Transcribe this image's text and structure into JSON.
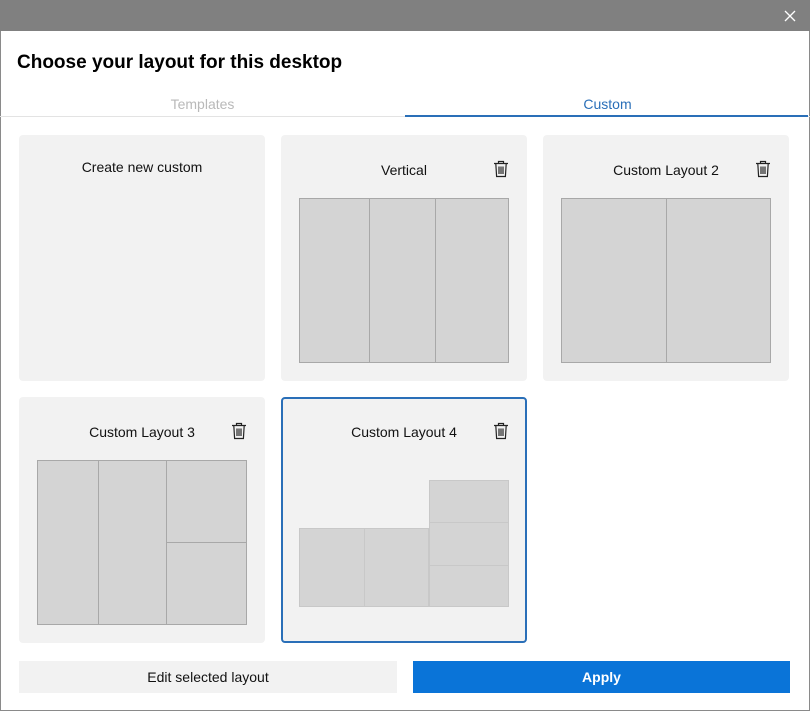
{
  "window": {
    "close_icon": "close-icon",
    "heading": "Choose your layout for this desktop"
  },
  "tabs": [
    {
      "label": "Templates",
      "active": false
    },
    {
      "label": "Custom",
      "active": true
    }
  ],
  "cards": {
    "create": {
      "label": "Create new custom"
    },
    "vertical": {
      "label": "Vertical",
      "zone_count": 3
    },
    "layout2": {
      "label": "Custom Layout 2",
      "zone_count": 2
    },
    "layout3": {
      "label": "Custom Layout 3",
      "zone_count": 4
    },
    "layout4": {
      "label": "Custom Layout 4",
      "zone_count": 5,
      "selected": true
    }
  },
  "footer": {
    "edit_label": "Edit selected layout",
    "apply_label": "Apply"
  },
  "colors": {
    "accent": "#2a6fb8",
    "apply_button": "#0a74d8",
    "titlebar": "#808080",
    "card": "#f2f2f2",
    "zone": "#d4d4d4"
  }
}
